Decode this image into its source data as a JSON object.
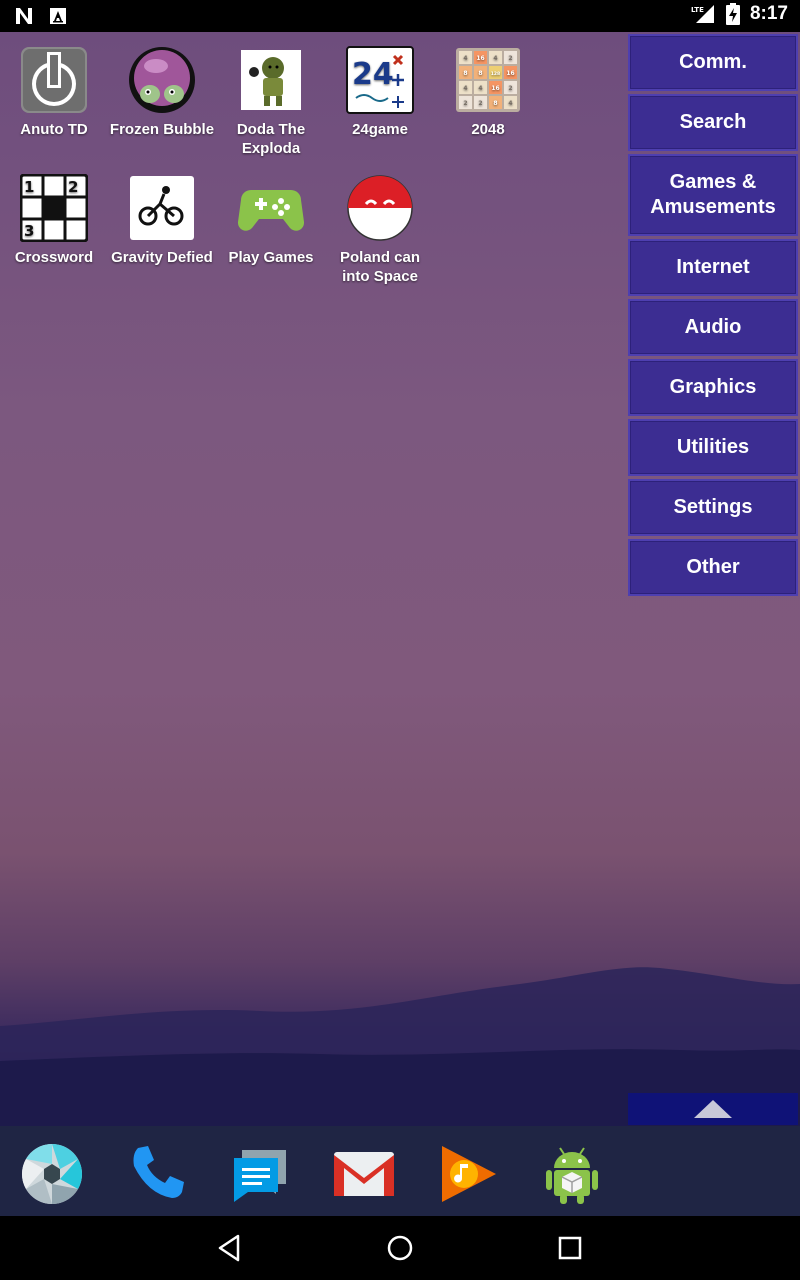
{
  "status_bar": {
    "time": "8:17",
    "left_icons": [
      "n-notification-icon",
      "a-notification-icon"
    ],
    "right_icons": [
      "lte-signal-icon",
      "battery-charging-icon"
    ],
    "network": "LTE"
  },
  "apps": [
    {
      "label": "Anuto TD",
      "icon": "anuto-td-icon"
    },
    {
      "label": "Frozen Bubble",
      "icon": "frozen-bubble-icon"
    },
    {
      "label": "Doda The Exploda",
      "icon": "doda-icon"
    },
    {
      "label": "24game",
      "icon": "24game-icon"
    },
    {
      "label": "2048",
      "icon": "2048-icon"
    },
    {
      "label": "Crossword",
      "icon": "crossword-icon"
    },
    {
      "label": "Gravity Defied",
      "icon": "gravity-defied-icon"
    },
    {
      "label": "Play Games",
      "icon": "play-games-icon"
    },
    {
      "label": "Poland can into Space",
      "icon": "poland-ball-icon"
    }
  ],
  "icon_text": {
    "n24": "24",
    "g2048": [
      "4",
      "16",
      "4",
      "2",
      "8",
      "8",
      "128",
      "16",
      "4",
      "4",
      "16",
      "2",
      "2",
      "2",
      "8",
      "4"
    ],
    "cw": [
      "1",
      "2",
      "3"
    ]
  },
  "categories": [
    {
      "label": "Comm."
    },
    {
      "label": "Search"
    },
    {
      "label": "Games & Amusements"
    },
    {
      "label": "Internet"
    },
    {
      "label": "Audio"
    },
    {
      "label": "Graphics"
    },
    {
      "label": "Utilities"
    },
    {
      "label": "Settings"
    },
    {
      "label": "Other"
    }
  ],
  "dock": [
    "camera-icon",
    "phone-icon",
    "messages-icon",
    "gmail-icon",
    "play-music-icon",
    "android-icon"
  ],
  "nav": [
    "back-icon",
    "home-icon",
    "recents-icon"
  ],
  "colors": {
    "category_bg": "#3c2d92",
    "dock_bg": "#1f2544",
    "up_button_bg": "#0f1277"
  }
}
